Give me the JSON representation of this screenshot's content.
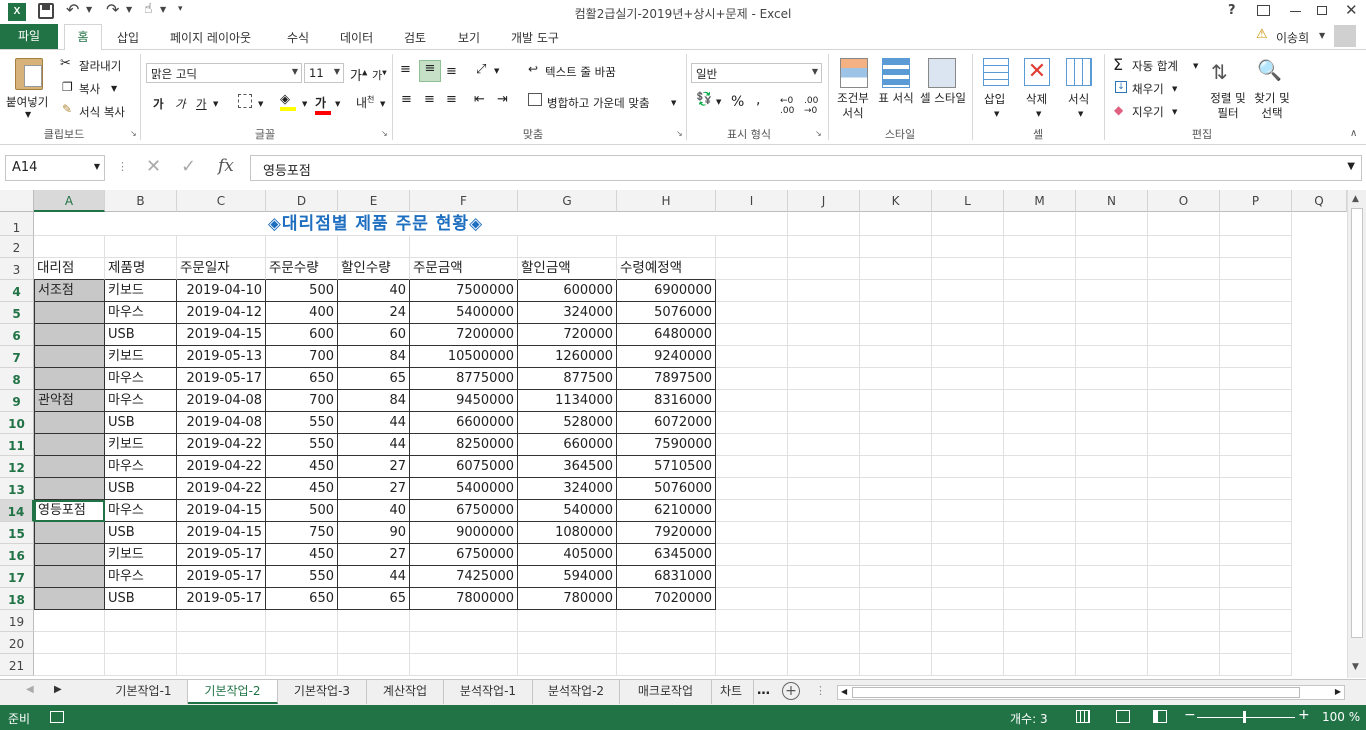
{
  "title": {
    "window_title": "컴활2급실기-2019년+상시+문제 - Excel",
    "user_name": "이송희",
    "qat_icons": [
      "excel-icon",
      "save-icon",
      "undo-icon",
      "redo-icon",
      "touch-icon",
      "customize-icon"
    ]
  },
  "tabs": [
    "파일",
    "홈",
    "삽입",
    "페이지 레이아웃",
    "수식",
    "데이터",
    "검토",
    "보기",
    "개발 도구"
  ],
  "ribbon": {
    "clipboard": {
      "paste": "붙여넣기",
      "cut": "잘라내기",
      "copy": "복사",
      "format_painter": "서식 복사",
      "label": "클립보드"
    },
    "font": {
      "name": "맑은 고딕",
      "size": "11",
      "bold": "가",
      "italic": "가",
      "underline": "가",
      "label": "글꼴"
    },
    "align": {
      "wrap": "텍스트 줄 바꿈",
      "merge": "병합하고 가운데 맞춤",
      "label": "맞춤"
    },
    "number": {
      "format": "일반",
      "label": "표시 형식"
    },
    "styles": {
      "conditional": "조건부 서식",
      "table": "표 서식",
      "cell": "셀 스타일",
      "label": "스타일"
    },
    "cells": {
      "insert": "삽입",
      "delete": "삭제",
      "format": "서식",
      "label": "셀"
    },
    "editing": {
      "autosum": "자동 합계",
      "fill": "채우기",
      "clear": "지우기",
      "sort": "정렬 및 필터",
      "find": "찾기 및 선택",
      "label": "편집"
    }
  },
  "formula_bar": {
    "name_box": "A14",
    "formula": "영등포점"
  },
  "columns": [
    "A",
    "B",
    "C",
    "D",
    "E",
    "F",
    "G",
    "H",
    "I",
    "J",
    "K",
    "L",
    "M",
    "N",
    "O",
    "P",
    "Q"
  ],
  "sheet": {
    "title": "◈대리점별 제품 주문 현황◈",
    "headers": [
      "대리점",
      "제품명",
      "주문일자",
      "주문수량",
      "할인수량",
      "주문금액",
      "할인금액",
      "수령예정액"
    ],
    "rows": [
      [
        "서조점",
        "키보드",
        "2019-04-10",
        "500",
        "40",
        "7500000",
        "600000",
        "6900000"
      ],
      [
        "",
        "마우스",
        "2019-04-12",
        "400",
        "24",
        "5400000",
        "324000",
        "5076000"
      ],
      [
        "",
        "USB",
        "2019-04-15",
        "600",
        "60",
        "7200000",
        "720000",
        "6480000"
      ],
      [
        "",
        "키보드",
        "2019-05-13",
        "700",
        "84",
        "10500000",
        "1260000",
        "9240000"
      ],
      [
        "",
        "마우스",
        "2019-05-17",
        "650",
        "65",
        "8775000",
        "877500",
        "7897500"
      ],
      [
        "관악점",
        "마우스",
        "2019-04-08",
        "700",
        "84",
        "9450000",
        "1134000",
        "8316000"
      ],
      [
        "",
        "USB",
        "2019-04-08",
        "550",
        "44",
        "6600000",
        "528000",
        "6072000"
      ],
      [
        "",
        "키보드",
        "2019-04-22",
        "550",
        "44",
        "8250000",
        "660000",
        "7590000"
      ],
      [
        "",
        "마우스",
        "2019-04-22",
        "450",
        "27",
        "6075000",
        "364500",
        "5710500"
      ],
      [
        "",
        "USB",
        "2019-04-22",
        "450",
        "27",
        "5400000",
        "324000",
        "5076000"
      ],
      [
        "영등포점",
        "마우스",
        "2019-04-15",
        "500",
        "40",
        "6750000",
        "540000",
        "6210000"
      ],
      [
        "",
        "USB",
        "2019-04-15",
        "750",
        "90",
        "9000000",
        "1080000",
        "7920000"
      ],
      [
        "",
        "키보드",
        "2019-05-17",
        "450",
        "27",
        "6750000",
        "405000",
        "6345000"
      ],
      [
        "",
        "마우스",
        "2019-05-17",
        "550",
        "44",
        "7425000",
        "594000",
        "6831000"
      ],
      [
        "",
        "USB",
        "2019-05-17",
        "650",
        "65",
        "7800000",
        "780000",
        "7020000"
      ]
    ],
    "row_numbers": [
      "1",
      "2",
      "3",
      "4",
      "5",
      "6",
      "7",
      "8",
      "9",
      "10",
      "11",
      "12",
      "13",
      "14",
      "15",
      "16",
      "17",
      "18",
      "19",
      "20",
      "21"
    ]
  },
  "sheet_tabs": [
    "기본작업-1",
    "기본작업-2",
    "기본작업-3",
    "계산작업",
    "분석작업-1",
    "분석작업-2",
    "매크로작업",
    "차트"
  ],
  "active_sheet_tab": "기본작업-2",
  "status": {
    "ready": "준비",
    "count": "개수: 3",
    "zoom": "100 %"
  },
  "colors": {
    "excel_green": "#217346",
    "title_blue": "#1f6fc0",
    "selected_gray": "#c8c8c8"
  }
}
